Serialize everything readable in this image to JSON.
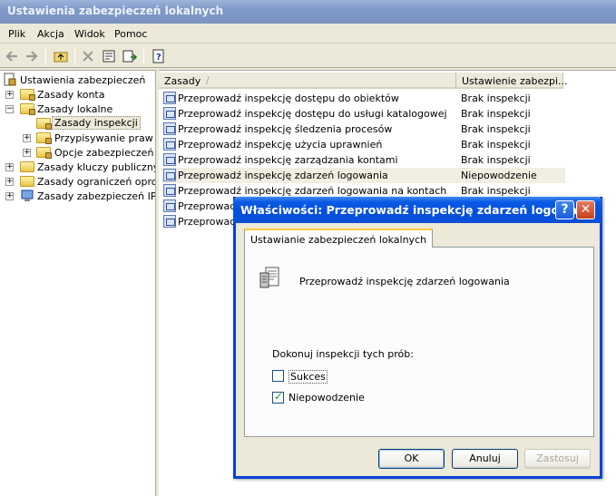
{
  "window": {
    "title": "Ustawienia zabezpieczeń lokalnych"
  },
  "menu": [
    "Plik",
    "Akcja",
    "Widok",
    "Pomoc"
  ],
  "toolbar_icons": [
    "back-arrow-icon",
    "forward-arrow-icon",
    "up-folder-icon",
    "delete-icon",
    "properties-icon",
    "export-list-icon",
    "help-icon"
  ],
  "tree": {
    "root": "Ustawienia zabezpieczeń",
    "nodes": [
      {
        "label": "Zasady konta"
      },
      {
        "label": "Zasady lokalne"
      },
      {
        "label": "Zasady inspekcji"
      },
      {
        "label": "Przypisywanie praw użytkownika"
      },
      {
        "label": "Opcje zabezpieczeń"
      },
      {
        "label": "Zasady kluczy publicznych"
      },
      {
        "label": "Zasady ograniczeń oprogramowania"
      },
      {
        "label": "Zasady zabezpieczeń IP w"
      }
    ]
  },
  "list": {
    "columns": [
      "Zasady",
      "Ustawienie zabezpi..."
    ],
    "rows": [
      {
        "name": "Przeprowadź inspekcję dostępu do obiektów",
        "value": "Brak inspekcji"
      },
      {
        "name": "Przeprowadź inspekcję dostępu do usługi katalogowej",
        "value": "Brak inspekcji"
      },
      {
        "name": "Przeprowadź inspekcję śledzenia procesów",
        "value": "Brak inspekcji"
      },
      {
        "name": "Przeprowadź inspekcję użycia uprawnień",
        "value": "Brak inspekcji"
      },
      {
        "name": "Przeprowadź inspekcję zarządzania kontami",
        "value": "Brak inspekcji"
      },
      {
        "name": "Przeprowadź inspekcję zdarzeń logowania",
        "value": "Niepowodzenie"
      },
      {
        "name": "Przeprowadź inspekcję zdarzeń logowania na kontach",
        "value": "Brak inspekcji"
      },
      {
        "name": "Przeprowadź",
        "value": ""
      },
      {
        "name": "Przeprowadź",
        "value": ""
      }
    ]
  },
  "dialog": {
    "title": "Właściwości: Przeprowadź inspekcję zdarzeń logowa...",
    "help": "?",
    "close": "✕",
    "tab": "Ustawianie zabezpieczeń lokalnych",
    "policy_name": "Przeprowadź inspekcję zdarzeń logowania",
    "group_label": "Dokonuj inspekcji tych prób:",
    "success_label": "Sukces",
    "success_checked": false,
    "failure_label": "Niepowodzenie",
    "failure_checked": true,
    "ok": "OK",
    "cancel": "Anuluj",
    "apply": "Zastosuj"
  }
}
